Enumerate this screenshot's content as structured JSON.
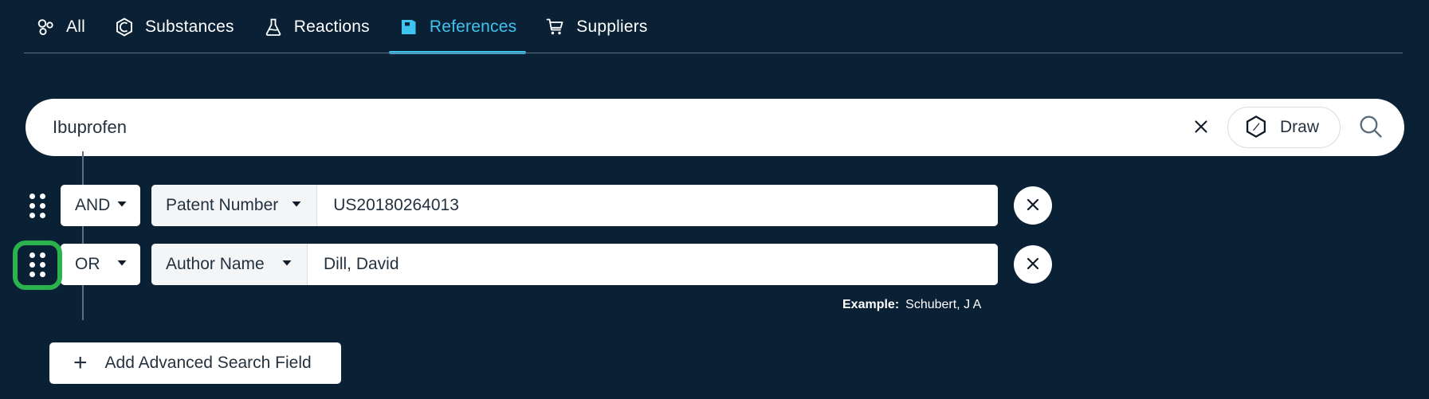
{
  "theme": {
    "background": "#0a2035",
    "accent": "#3fc3f0",
    "annotation": "#2bb24c",
    "field_background": "#ffffff",
    "text_dark": "#24323f",
    "text_light": "#ffffff"
  },
  "tabs": [
    {
      "id": "all",
      "label": "All",
      "icon": "circles-cluster-icon",
      "active": false
    },
    {
      "id": "substances",
      "label": "Substances",
      "icon": "hexagon-molecule-icon",
      "active": false
    },
    {
      "id": "reactions",
      "label": "Reactions",
      "icon": "flask-icon",
      "active": false
    },
    {
      "id": "references",
      "label": "References",
      "icon": "book-icon",
      "active": true
    },
    {
      "id": "suppliers",
      "label": "Suppliers",
      "icon": "shopping-cart-icon",
      "active": false
    }
  ],
  "search": {
    "value": "Ibuprofen",
    "placeholder": "Search",
    "clear_icon": "close-icon",
    "draw_label": "Draw",
    "draw_icon": "hexagon-pencil-icon",
    "submit_icon": "search-icon"
  },
  "advanced_rows": [
    {
      "handle_icon": "drag-handle-icon",
      "operator": "AND",
      "field": "Patent Number",
      "value": "US20180264013",
      "remove_icon": "close-icon",
      "hint_label": "",
      "hint_value": ""
    },
    {
      "handle_icon": "drag-handle-icon",
      "operator": "OR",
      "field": "Author Name",
      "value": "Dill, David",
      "remove_icon": "close-icon",
      "hint_label": "Example:",
      "hint_value": "Schubert, J A"
    }
  ],
  "add_field_button": {
    "label": "Add Advanced Search Field",
    "icon": "plus-icon"
  },
  "annotation": {
    "target": "drag-handle of second advanced search row",
    "color": "#2bb24c"
  }
}
